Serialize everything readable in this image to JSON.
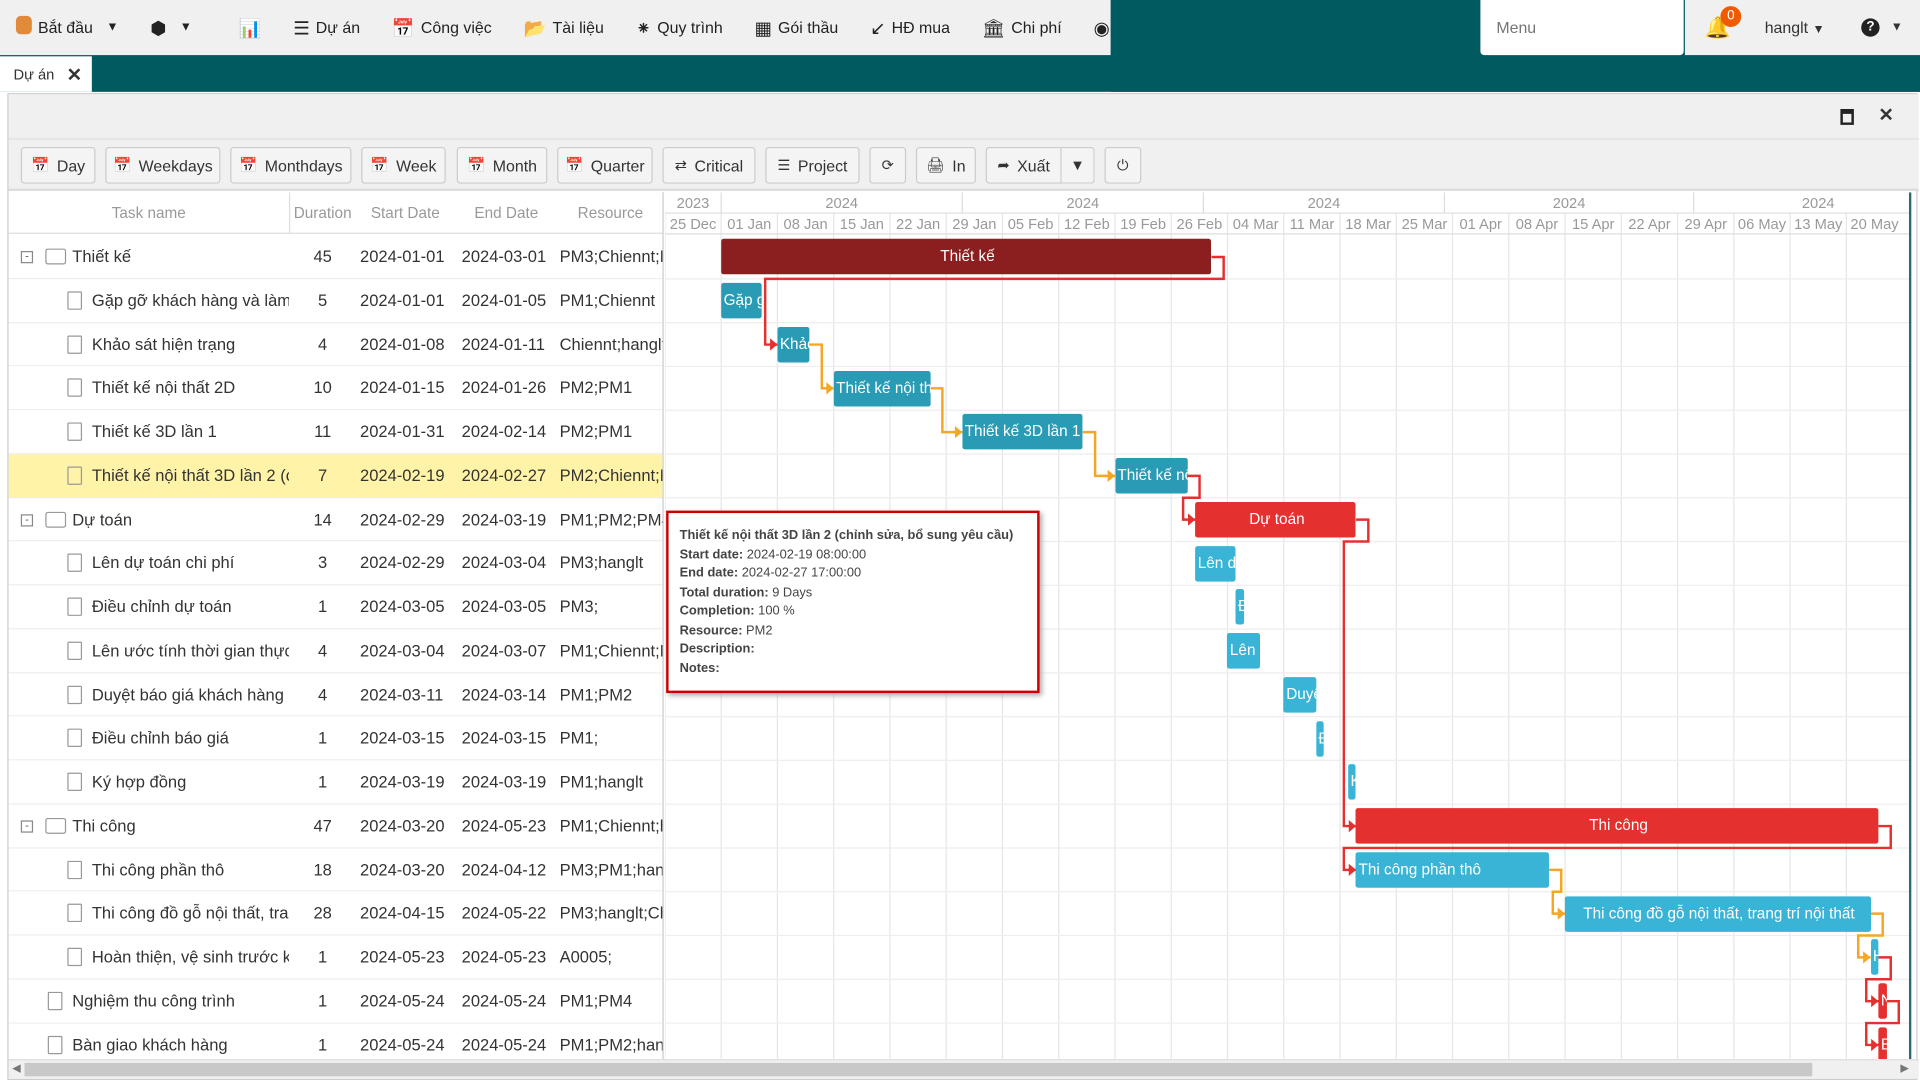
{
  "nav": {
    "items": [
      {
        "label": "Bắt đầu",
        "icon": "start-icon",
        "caret": true
      },
      {
        "label": "",
        "icon": "box-icon",
        "caret": true
      },
      {
        "label": "",
        "icon": "chart-icon"
      },
      {
        "label": "Dự án",
        "icon": "project-icon"
      },
      {
        "label": "Công việc",
        "icon": "calendar-icon"
      },
      {
        "label": "Tài liệu",
        "icon": "folder-icon"
      },
      {
        "label": "Quy trình",
        "icon": "spinner-icon"
      },
      {
        "label": "Gói thầu",
        "icon": "grid-icon"
      },
      {
        "label": "HĐ mua",
        "icon": "compress-icon"
      },
      {
        "label": "Chi phí",
        "icon": "bank-icon"
      },
      {
        "label": "",
        "icon": "dashboard-icon"
      }
    ],
    "menu_placeholder": "Menu",
    "notification_count": "0",
    "user": "hanglt"
  },
  "tab": {
    "label": "Dự án"
  },
  "toolbar": {
    "buttons": [
      "Day",
      "Weekdays",
      "Monthdays",
      "Week",
      "Month",
      "Quarter",
      "Critical",
      "Project",
      "",
      "In",
      "Xuất",
      ""
    ]
  },
  "grid": {
    "headers": [
      "Task name",
      "Duration",
      "Start Date",
      "End Date",
      "Resource"
    ]
  },
  "tasks": [
    {
      "name": "Thiết kế",
      "duration": "45",
      "start": "2024-01-01",
      "end": "2024-03-01",
      "resource": "PM3;Chiennt;P",
      "type": "parent",
      "level": 0,
      "color": "#8b1e1e"
    },
    {
      "name": "Gặp gỡ khách hàng và làm",
      "duration": "5",
      "start": "2024-01-01",
      "end": "2024-01-05",
      "resource": "PM1;Chiennt",
      "type": "task",
      "level": 1,
      "color": "#2a9bb5"
    },
    {
      "name": "Khảo sát hiện trạng",
      "duration": "4",
      "start": "2024-01-08",
      "end": "2024-01-11",
      "resource": "Chiennt;hanglt",
      "type": "task",
      "level": 1,
      "color": "#2a9bb5"
    },
    {
      "name": "Thiết kế nội thất 2D",
      "duration": "10",
      "start": "2024-01-15",
      "end": "2024-01-26",
      "resource": "PM2;PM1",
      "type": "task",
      "level": 1,
      "color": "#2a9bb5"
    },
    {
      "name": "Thiết kế 3D lần 1",
      "duration": "11",
      "start": "2024-01-31",
      "end": "2024-02-14",
      "resource": "PM2;PM1",
      "type": "task",
      "level": 1,
      "color": "#2a9bb5"
    },
    {
      "name": "Thiết kế nội thất 3D lần 2 (chỉnh sửa, bổ sung yêu cầu)",
      "duration": "7",
      "start": "2024-02-19",
      "end": "2024-02-27",
      "resource": "PM2;Chiennt;P",
      "type": "task",
      "level": 1,
      "color": "#2a9bb5",
      "selected": true
    },
    {
      "name": "Dự toán",
      "duration": "14",
      "start": "2024-02-29",
      "end": "2024-03-19",
      "resource": "PM1;PM2;PM4",
      "type": "parent",
      "level": 0,
      "color": "#e53030"
    },
    {
      "name": "Lên dự toán chi phí",
      "duration": "3",
      "start": "2024-02-29",
      "end": "2024-03-04",
      "resource": "PM3;hanglt",
      "type": "task",
      "level": 1,
      "color": "#3ab4d6"
    },
    {
      "name": "Điều chỉnh dự toán",
      "duration": "1",
      "start": "2024-03-05",
      "end": "2024-03-05",
      "resource": "PM3;",
      "type": "task",
      "level": 1,
      "color": "#3ab4d6"
    },
    {
      "name": "Lên ước tính thời gian thực",
      "duration": "4",
      "start": "2024-03-04",
      "end": "2024-03-07",
      "resource": "PM1;Chiennt;P",
      "type": "task",
      "level": 1,
      "color": "#3ab4d6"
    },
    {
      "name": "Duyệt báo giá khách hàng",
      "duration": "4",
      "start": "2024-03-11",
      "end": "2024-03-14",
      "resource": "PM1;PM2",
      "type": "task",
      "level": 1,
      "color": "#3ab4d6"
    },
    {
      "name": "Điều chỉnh báo giá",
      "duration": "1",
      "start": "2024-03-15",
      "end": "2024-03-15",
      "resource": "PM1;",
      "type": "task",
      "level": 1,
      "color": "#3ab4d6"
    },
    {
      "name": "Ký hợp đồng",
      "duration": "1",
      "start": "2024-03-19",
      "end": "2024-03-19",
      "resource": "PM1;hanglt",
      "type": "task",
      "level": 1,
      "color": "#3ab4d6"
    },
    {
      "name": "Thi công",
      "duration": "47",
      "start": "2024-03-20",
      "end": "2024-05-23",
      "resource": "PM1;Chiennt;h",
      "type": "parent",
      "level": 0,
      "color": "#e53030"
    },
    {
      "name": "Thi công phần thô",
      "duration": "18",
      "start": "2024-03-20",
      "end": "2024-04-12",
      "resource": "PM3;PM1;han",
      "type": "task",
      "level": 1,
      "color": "#3ab4d6"
    },
    {
      "name": "Thi công đồ gỗ nội thất, trang trí nội thất",
      "duration": "28",
      "start": "2024-04-15",
      "end": "2024-05-22",
      "resource": "PM3;hanglt;Ch",
      "type": "task",
      "level": 1,
      "color": "#3ab4d6"
    },
    {
      "name": "Hoàn thiện, vệ sinh trước k",
      "duration": "1",
      "start": "2024-05-23",
      "end": "2024-05-23",
      "resource": "A0005;",
      "type": "task",
      "level": 1,
      "color": "#3ab4d6"
    },
    {
      "name": "Nghiệm thu công trình",
      "duration": "1",
      "start": "2024-05-24",
      "end": "2024-05-24",
      "resource": "PM1;PM4",
      "type": "task",
      "level": 0,
      "color": "#e53030"
    },
    {
      "name": "Bàn giao khách hàng",
      "duration": "1",
      "start": "2024-05-24",
      "end": "2024-05-24",
      "resource": "PM1;PM2;han",
      "type": "task",
      "level": 0,
      "color": "#e53030"
    }
  ],
  "timeline": {
    "years": [
      {
        "label": "2023",
        "from": "2023-12-25",
        "to": "2024-01-01"
      },
      {
        "label": "2024",
        "from": "2024-01-01",
        "to": "2024-01-31"
      },
      {
        "label": "2024",
        "from": "2024-01-31",
        "to": "2024-03-01"
      },
      {
        "label": "2024",
        "from": "2024-03-01",
        "to": "2024-03-31"
      },
      {
        "label": "2024",
        "from": "2024-03-31",
        "to": "2024-05-01"
      },
      {
        "label": "2024",
        "from": "2024-05-01",
        "to": "2024-06-01"
      }
    ],
    "weeks": [
      "25 Dec",
      "01 Jan",
      "08 Jan",
      "15 Jan",
      "22 Jan",
      "29 Jan",
      "05 Feb",
      "12 Feb",
      "19 Feb",
      "26 Feb",
      "04 Mar",
      "11 Mar",
      "18 Mar",
      "25 Mar",
      "01 Apr",
      "08 Apr",
      "15 Apr",
      "22 Apr",
      "29 Apr",
      "06 May",
      "13 May",
      "20 May"
    ],
    "origin": "2023-12-25"
  },
  "links": [
    {
      "from": 0,
      "to": 2,
      "critical": true
    },
    {
      "from": 2,
      "to": 3,
      "critical": false
    },
    {
      "from": 3,
      "to": 4,
      "critical": false
    },
    {
      "from": 4,
      "to": 5,
      "critical": false
    },
    {
      "from": 5,
      "to": 6,
      "critical": true
    },
    {
      "from": 6,
      "to": 13,
      "critical": true
    },
    {
      "from": 13,
      "to": 14,
      "critical": true
    },
    {
      "from": 14,
      "to": 15,
      "critical": false
    },
    {
      "from": 15,
      "to": 16,
      "critical": false
    },
    {
      "from": 16,
      "to": 17,
      "critical": true
    },
    {
      "from": 17,
      "to": 18,
      "critical": true
    }
  ],
  "colors": {
    "link": "#f5a623",
    "critical_link": "#e53030",
    "selected_row": "#fff3a8",
    "header": "#005a60"
  },
  "tooltip": {
    "title": "Thiết kế nội thất 3D lần 2 (chỉnh sửa, bổ sung yêu cầu)",
    "lines": [
      {
        "k": "Start date:",
        "v": "2024-02-19 08:00:00"
      },
      {
        "k": "End date:",
        "v": "2024-02-27 17:00:00"
      },
      {
        "k": "Total duration:",
        "v": "9 Days"
      },
      {
        "k": "Completion:",
        "v": "100 %"
      },
      {
        "k": "Resource:",
        "v": "PM2"
      },
      {
        "k": "Description:",
        "v": ""
      },
      {
        "k": "Notes:",
        "v": ""
      }
    ]
  }
}
